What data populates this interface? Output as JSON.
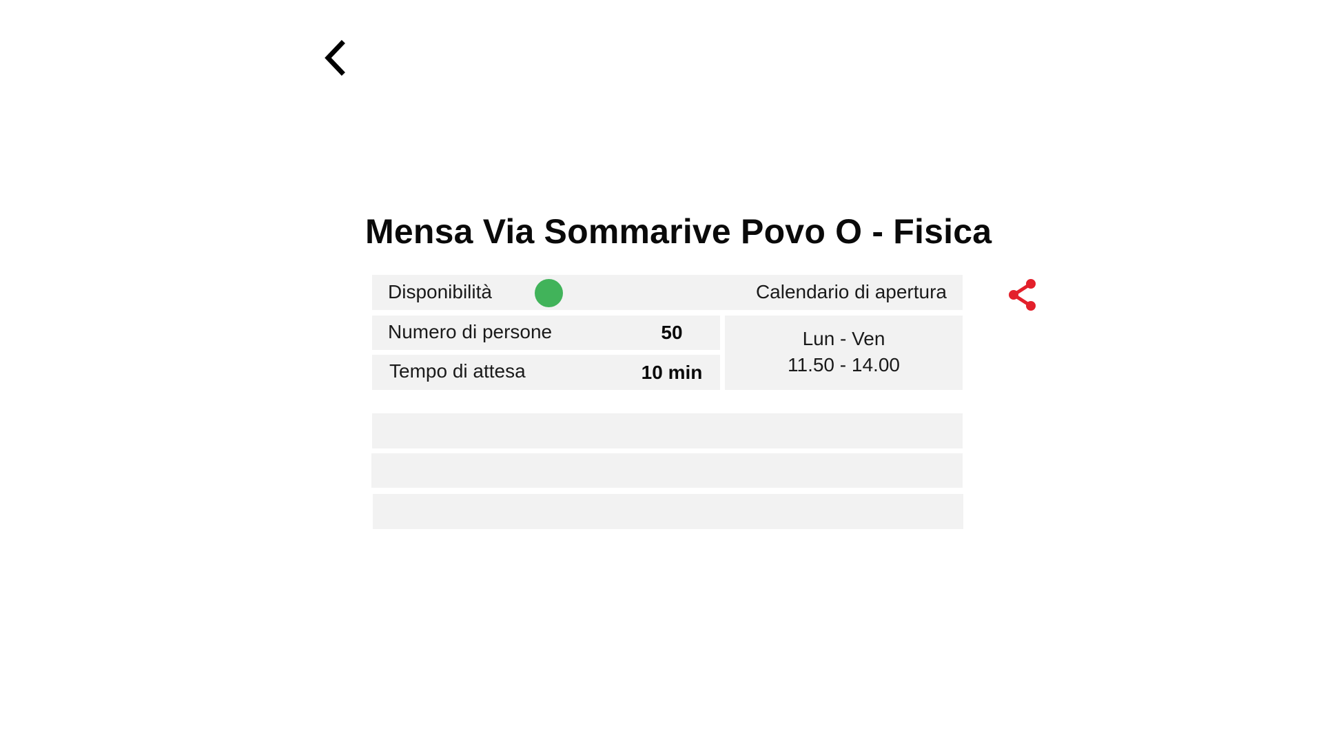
{
  "header": {
    "back_icon": "chevron-left-icon",
    "title": "Mensa Via Sommarive Povo O - Fisica"
  },
  "info": {
    "availability_label": "Disponibilità",
    "availability_status_color": "#41b35a",
    "calendar_label": "Calendario di apertura",
    "people_label": "Numero di persone",
    "people_value": "50",
    "wait_label": "Tempo di attesa",
    "wait_value": "10 min",
    "schedule_days": "Lun - Ven",
    "schedule_hours": "11.50 - 14.00"
  },
  "actions": {
    "share_icon": "share-icon",
    "share_color": "#e3202b"
  },
  "colors": {
    "cell_background": "#f2f2f2",
    "text": "#111111"
  }
}
